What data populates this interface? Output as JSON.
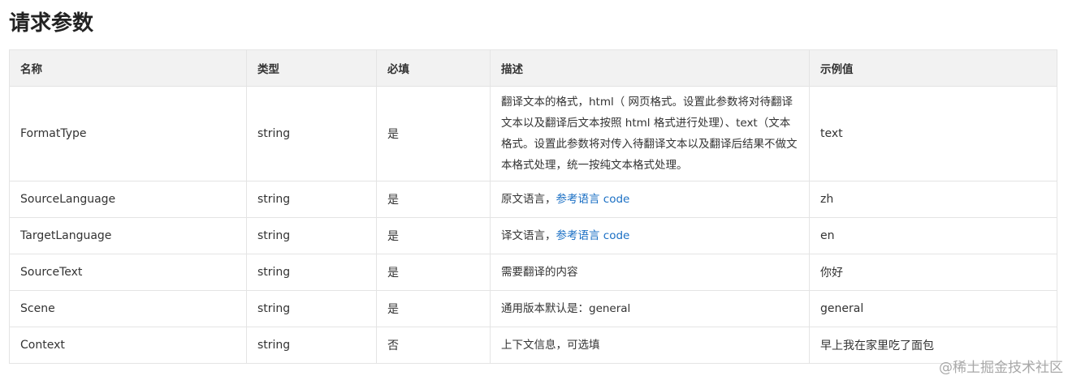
{
  "title": "请求参数",
  "table": {
    "headers": [
      "名称",
      "类型",
      "必填",
      "描述",
      "示例值"
    ],
    "rows": [
      {
        "name": "FormatType",
        "type": "string",
        "required": "是",
        "desc": "翻译文本的格式，html（ 网页格式。设置此参数将对待翻译文本以及翻译后文本按照 html 格式进行处理）、text（文本格式。设置此参数将对传入待翻译文本以及翻译后结果不做文本格式处理，统一按纯文本格式处理。",
        "desc_link": "",
        "example": "text"
      },
      {
        "name": "SourceLanguage",
        "type": "string",
        "required": "是",
        "desc": "原文语言，",
        "desc_link": "参考语言 code",
        "example": "zh"
      },
      {
        "name": "TargetLanguage",
        "type": "string",
        "required": "是",
        "desc": "译文语言，",
        "desc_link": "参考语言 code",
        "example": "en"
      },
      {
        "name": "SourceText",
        "type": "string",
        "required": "是",
        "desc": "需要翻译的内容",
        "desc_link": "",
        "example": "你好"
      },
      {
        "name": "Scene",
        "type": "string",
        "required": "是",
        "desc": "通用版本默认是：general",
        "desc_link": "",
        "example": "general"
      },
      {
        "name": "Context",
        "type": "string",
        "required": "否",
        "desc": "上下文信息，可选填",
        "desc_link": "",
        "example": "早上我在家里吃了面包"
      }
    ]
  },
  "watermark": "@稀土掘金技术社区",
  "colors": {
    "link": "#1a6fc4",
    "header_bg": "#f2f2f2",
    "border": "#e4e4e4"
  }
}
